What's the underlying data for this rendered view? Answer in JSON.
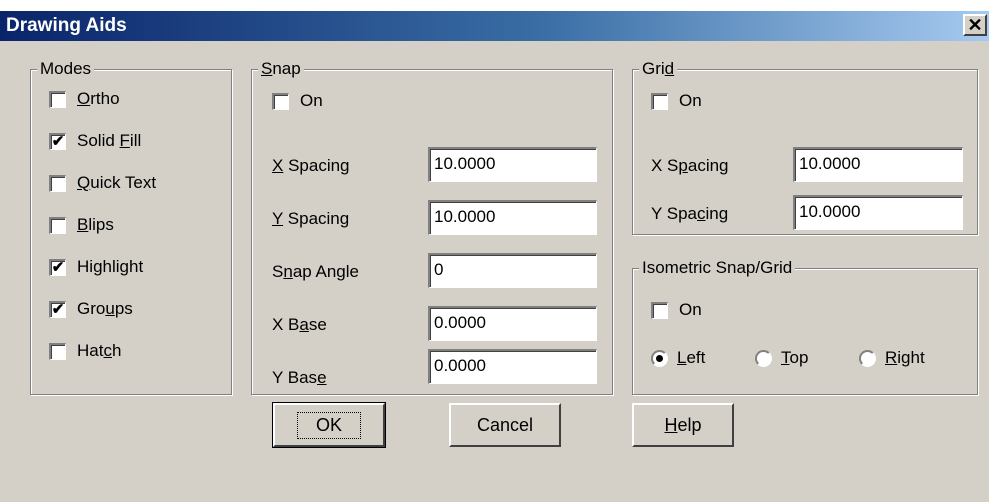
{
  "window": {
    "title": "Drawing Aids",
    "close_glyph": "✕"
  },
  "modes": {
    "legend": "Modes",
    "items": [
      {
        "pre": "",
        "u": "O",
        "post": "rtho",
        "checked": false
      },
      {
        "pre": "Solid ",
        "u": "F",
        "post": "ill",
        "checked": true
      },
      {
        "pre": "",
        "u": "Q",
        "post": "uick Text",
        "checked": false
      },
      {
        "pre": "",
        "u": "B",
        "post": "lips",
        "checked": false
      },
      {
        "pre": "Hi",
        "u": "g",
        "post": "hlight",
        "checked": true
      },
      {
        "pre": "Gro",
        "u": "u",
        "post": "ps",
        "checked": true
      },
      {
        "pre": "Hat",
        "u": "c",
        "post": "h",
        "checked": false
      }
    ]
  },
  "snap": {
    "legend_u": "S",
    "legend_post": "nap",
    "on_label": "On",
    "on_checked": false,
    "fields": [
      {
        "pre": "",
        "u": "X",
        "post": " Spacing",
        "value": "10.0000"
      },
      {
        "pre": "",
        "u": "Y",
        "post": " Spacing",
        "value": "10.0000"
      },
      {
        "pre": "S",
        "u": "n",
        "post": "ap Angle",
        "value": "0"
      },
      {
        "pre": "X B",
        "u": "a",
        "post": "se",
        "value": "0.0000"
      },
      {
        "pre": "Y Bas",
        "u": "e",
        "post": "",
        "value": "0.0000"
      }
    ]
  },
  "grid": {
    "legend_pre": "Gri",
    "legend_u": "d",
    "on_label": "On",
    "on_checked": false,
    "fields": [
      {
        "pre": "X S",
        "u": "p",
        "post": "acing",
        "value": "10.0000"
      },
      {
        "pre": "Y Spa",
        "u": "c",
        "post": "ing",
        "value": "10.0000"
      }
    ]
  },
  "iso": {
    "legend": "Isometric Snap/Grid",
    "on_label": "On",
    "on_checked": false,
    "radios": [
      {
        "u": "L",
        "post": "eft",
        "selected": true
      },
      {
        "u": "T",
        "post": "op",
        "selected": false
      },
      {
        "u": "R",
        "post": "ight",
        "selected": false
      }
    ]
  },
  "buttons": {
    "ok": "OK",
    "cancel": "Cancel",
    "help_u": "H",
    "help_post": "elp"
  },
  "check_glyph": "✔"
}
